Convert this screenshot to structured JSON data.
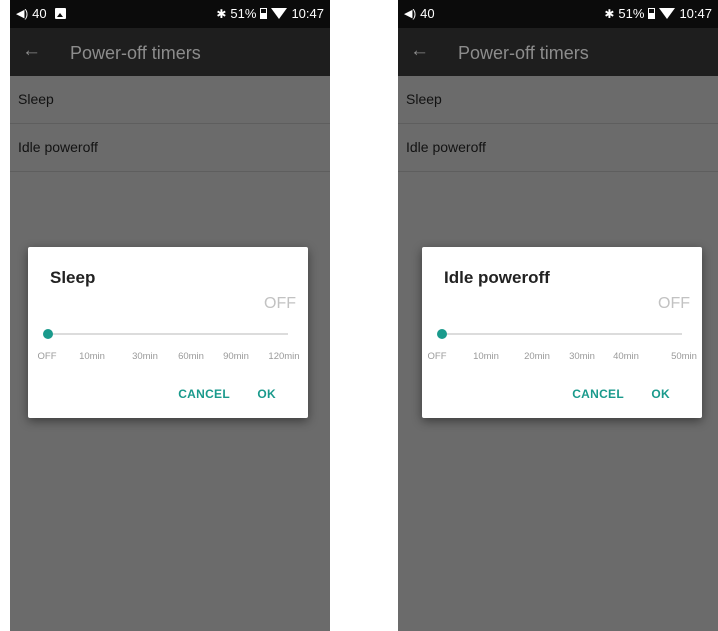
{
  "colors": {
    "accent": "#1a9a8c",
    "scrim_background": "#6b6b6b",
    "appbar_background": "#1e1e1e",
    "statusbar_background": "#0b0b0b",
    "dialog_background": "#ffffff"
  },
  "screens": [
    {
      "statusbar": {
        "volume_icon": "volume-icon",
        "volume_level": "40",
        "battery_percent": "51%",
        "time": "10:47",
        "icons": [
          "volume-icon",
          "image-icon",
          "bluetooth-icon",
          "battery-icon",
          "wifi-icon"
        ]
      },
      "appbar": {
        "back_icon": "back-arrow-icon",
        "title": "Power-off timers"
      },
      "list": [
        {
          "label": "Sleep"
        },
        {
          "label": "Idle poweroff"
        }
      ],
      "dialog": {
        "title": "Sleep",
        "value": "OFF",
        "slider_position": 0,
        "ticks": [
          "OFF",
          "10min",
          "30min",
          "60min",
          "90min",
          "120min"
        ],
        "cancel_label": "CANCEL",
        "ok_label": "OK"
      }
    },
    {
      "statusbar": {
        "volume_icon": "volume-icon",
        "volume_level": "40",
        "battery_percent": "51%",
        "time": "10:47",
        "icons": [
          "volume-icon",
          "bluetooth-icon",
          "battery-icon",
          "wifi-icon"
        ]
      },
      "appbar": {
        "back_icon": "back-arrow-icon",
        "title": "Power-off timers"
      },
      "list": [
        {
          "label": "Sleep"
        },
        {
          "label": "Idle poweroff"
        }
      ],
      "dialog": {
        "title": "Idle poweroff",
        "value": "OFF",
        "slider_position": 0,
        "ticks": [
          "OFF",
          "10min",
          "20min",
          "30min",
          "40min",
          "50min"
        ],
        "cancel_label": "CANCEL",
        "ok_label": "OK"
      }
    }
  ]
}
